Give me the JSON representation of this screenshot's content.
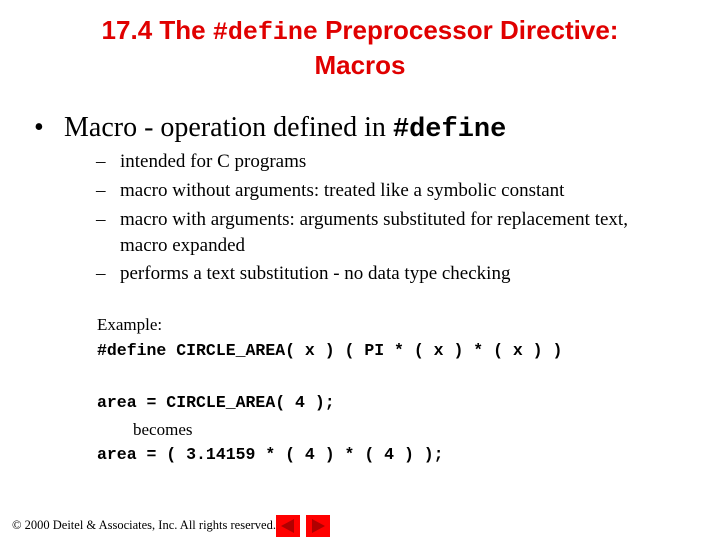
{
  "title": {
    "prefix": "17.4 The ",
    "code": "#define",
    "suffix": " Preprocessor Directive:",
    "line2": "Macros"
  },
  "bullet": {
    "text": "Macro - operation defined in ",
    "code": "#define"
  },
  "sub_bullets": [
    {
      "line1": "intended for C programs"
    },
    {
      "line1": "macro without arguments: treated like a symbolic constant"
    },
    {
      "line1": "macro with arguments: arguments substituted for replacement text,",
      "line2": "macro expanded"
    },
    {
      "line1": "performs a text substitution - no data type checking"
    }
  ],
  "example": {
    "label": "Example:",
    "define_line": "#define CIRCLE_AREA( x ) ( PI * ( x ) * ( x ) )",
    "call_line": "area = CIRCLE_AREA( 4 );",
    "becomes": "becomes",
    "expanded_line": "area = ( 3.14159 * ( 4 ) * ( 4 ) );"
  },
  "footer": {
    "copyright": "© 2000 Deitel & Associates, Inc.  All rights reserved."
  },
  "nav": {
    "prev_icon": "triangle-left",
    "next_icon": "triangle-right",
    "button_color": "#ff0000",
    "arrow_color": "#b00000"
  }
}
